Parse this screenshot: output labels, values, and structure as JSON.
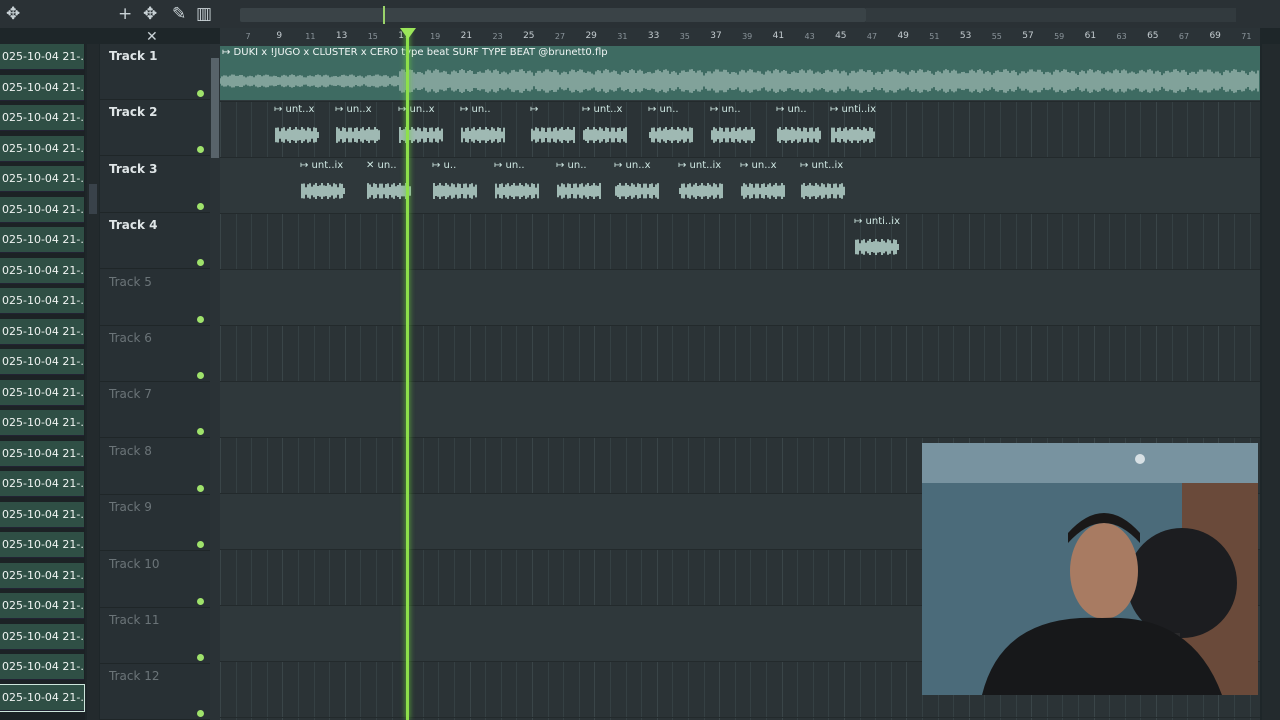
{
  "toolbar": {
    "add_icon": "+",
    "close_icon": "✕",
    "snap_icon": "✥",
    "pencil_icon": "✎",
    "piano_icon": "▥"
  },
  "clips": [
    "025-10-04 21-...",
    "025-10-04 21-...",
    "025-10-04 21-...",
    "025-10-04 21-...",
    "025-10-04 21-...",
    "025-10-04 21-...",
    "025-10-04 21-...",
    "025-10-04 21-...",
    "025-10-04 21-...",
    "025-10-04 21-...",
    "025-10-04 21-...",
    "025-10-04 21-...",
    "025-10-04 21-...",
    "025-10-04 21-...",
    "025-10-04 21-...",
    "025-10-04 21-...",
    "025-10-04 21-...",
    "025-10-04 21-...",
    "025-10-04 21-...",
    "025-10-04 21-...",
    "025-10-04 21-...",
    "025-10-04 21-..."
  ],
  "tracks": [
    "Track 1",
    "Track 2",
    "Track 3",
    "Track 4",
    "Track 5",
    "Track 6",
    "Track 7",
    "Track 8",
    "Track 9",
    "Track 10",
    "Track 11",
    "Track 12"
  ],
  "ruler_ticks": [
    "7",
    "9",
    "11",
    "13",
    "15",
    "17",
    "19",
    "21",
    "23",
    "25",
    "27",
    "29",
    "31",
    "33",
    "35",
    "37",
    "39",
    "41",
    "43",
    "45",
    "47",
    "49",
    "51",
    "53",
    "55",
    "57",
    "59",
    "61",
    "63",
    "65",
    "67",
    "69",
    "71"
  ],
  "main_audio_label": "↦ DUKI x !JUGO x CLUSTER x CERO type beat  SURF TYPE BEAT @brunett0.flp",
  "track2_patterns": [
    "↦ unt..x",
    "↦ un..x",
    "↦ un..x",
    "↦ un..",
    "↦",
    "↦ unt..x",
    "↦ un..",
    "↦ un..",
    "↦ un..",
    "↦ unti..ix"
  ],
  "track3_patterns": [
    "↦ unt..ix",
    "✕ un..",
    "↦ u..",
    "↦ un..",
    "↦ un..",
    "↦ un..x",
    "↦ unt..ix",
    "↦ un..x",
    "↦ unt..ix"
  ],
  "track4_patterns": [
    "↦ unti..ix"
  ],
  "colors": {
    "accent": "#8ee04b",
    "clip": "#2f4f45",
    "audio": "#3e6b62"
  }
}
